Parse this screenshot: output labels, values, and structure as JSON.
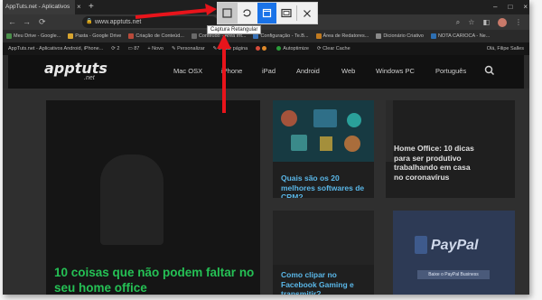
{
  "browser": {
    "tab_title": "AppTuts.net - Aplicativos",
    "tab_close": "×",
    "tab_new": "+",
    "url": "www.apptuts.net",
    "back": "←",
    "forward": "→",
    "reload": "⟳",
    "window_controls": [
      "–",
      "□",
      "×"
    ]
  },
  "capture_toolbar": {
    "buttons": [
      {
        "name": "rectangle-capture",
        "icon": "rectangle-select-icon"
      },
      {
        "name": "freeform-capture",
        "icon": "freeform-icon"
      },
      {
        "name": "window-capture",
        "icon": "window-icon"
      },
      {
        "name": "fullscreen-capture",
        "icon": "fullscreen-icon"
      },
      {
        "name": "close",
        "icon": "close-icon"
      }
    ],
    "tooltip": "Captura Retangular"
  },
  "bookmarks": [
    "Meu Drive - Google...",
    "Pasta - Google Drive",
    "Criação de Conteúd...",
    "Conteúdo - Área Int...",
    "Configuração - Te.B...",
    "Área de Redatores...",
    "Dicionário Criativo",
    "NOTA CARIOCA - Ne..."
  ],
  "wp_admin": {
    "site": "AppTuts.net - Aplicativos Android, iPhone...",
    "updates": "2",
    "comments": "87",
    "new": "Novo",
    "customize": "Personalizar",
    "edit": "Editar página",
    "autoptimize": "Autoptimize",
    "clear_cache": "Clear Cache",
    "greeting": "Olá, Filipe Salles"
  },
  "site": {
    "logo": "apptuts",
    "logo_sub": ".net",
    "menu": [
      "Mac OSX",
      "iPhone",
      "iPad",
      "Android",
      "Web",
      "Windows PC",
      "Português"
    ]
  },
  "articles": {
    "featured": "10 coisas que não podem faltar no seu home office",
    "crm": "Quais são os 20 melhores softwares de CRM?",
    "home_office": "Home Office: 10 dicas para ser produtivo trabalhando em casa no coronavírus",
    "facebook": "Como clipar no Facebook Gaming e transmitir?"
  },
  "ad": {
    "brand": "PayPal",
    "button": "Baixe o PayPal Business"
  },
  "colors": {
    "annotation": "#e8141b",
    "featured_title": "#25c155",
    "link_title": "#5ab7e8",
    "capture_active": "#1a73e8"
  }
}
